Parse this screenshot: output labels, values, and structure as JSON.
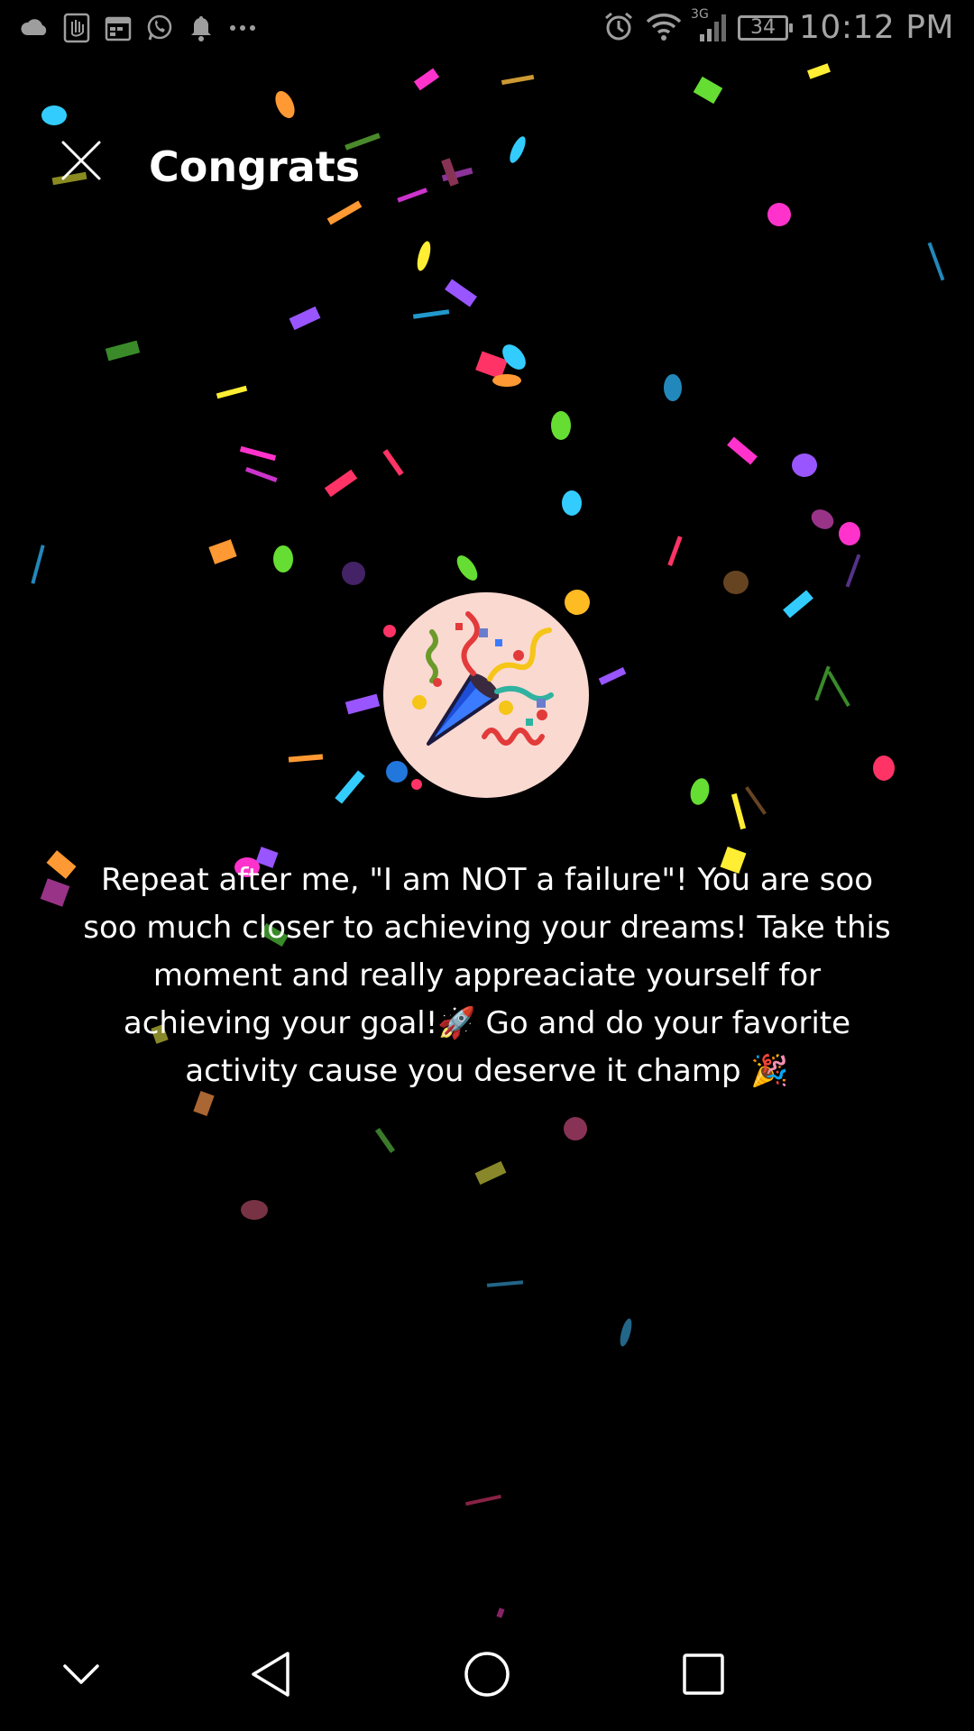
{
  "status_bar": {
    "time": "10:12 PM",
    "battery_level": "34",
    "network_type": "3G",
    "left_icons": [
      "cloud-icon",
      "hand-icon",
      "calendar-icon",
      "whatsapp-icon",
      "bell-icon",
      "more-dots-icon"
    ],
    "right_icons": [
      "alarm-icon",
      "wifi-icon",
      "signal-icon",
      "battery-icon"
    ]
  },
  "header": {
    "title": "Congrats",
    "close_icon": "close-icon"
  },
  "illustration": {
    "icon": "party-popper-icon",
    "background_color": "#fad9d1"
  },
  "message": {
    "text": "Repeat after me, \"I am NOT a failure\"! You are soo soo much closer to achieving your dreams! Take this moment and really appreaciate yourself for achieving your goal!🚀 Go and do your favorite activity cause you deserve it champ 🎉"
  },
  "nav_bar": {
    "icons": [
      "chevron-down-icon",
      "back-triangle-icon",
      "home-circle-icon",
      "recents-square-icon"
    ]
  },
  "colors": {
    "background": "#000000",
    "title": "#ffffff",
    "status": "#9e9e9e",
    "confetti": [
      "#ff33cc",
      "#33ccff",
      "#ffee33",
      "#66dd33",
      "#ff3366",
      "#9955ff",
      "#ff9933",
      "#33dd99",
      "#cc3366",
      "#2288bb"
    ]
  }
}
